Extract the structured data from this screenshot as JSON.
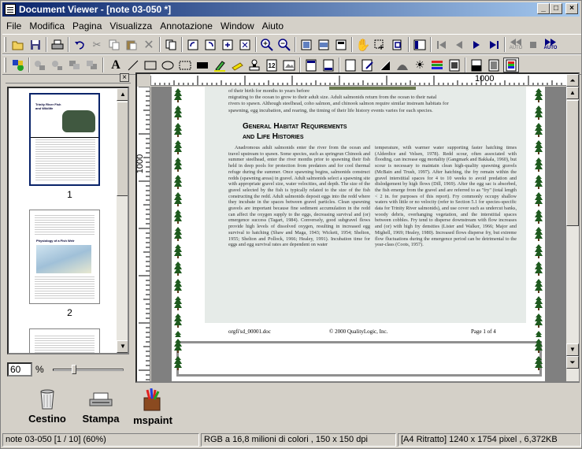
{
  "window": {
    "title": "Document Viewer - [note 03-050 *]"
  },
  "menu": [
    "File",
    "Modifica",
    "Pagina",
    "Visualizza",
    "Annotazione",
    "Window",
    "Aiuto"
  ],
  "toolbar1": {
    "auto1": "AUTO",
    "auto2": "AUTO"
  },
  "thumbs": {
    "page1": "1",
    "page2": "2",
    "t1_title": "Trinity River Fish and Wildlife",
    "t2_title": "Physiology of a Fish Weir"
  },
  "zoom": {
    "value": "60",
    "unit": "%"
  },
  "ruler": {
    "h_label": "1000",
    "v_label": "1000"
  },
  "doc": {
    "top_line1": "of their birth for months to years before",
    "top_line2": "migrating to the ocean to grow to their adult size. Adult salmonids return from the ocean to their natal",
    "top_line3": "rivers to spawn. Although steelhead, coho salmon, and chinook salmon require similar instream habitats for",
    "top_line4": "spawning, egg incubation, and rearing, the timing of their life history events varies for each species.",
    "heading1": "General Habitat Requirements",
    "heading2": "and Life Histories",
    "col1": "Anadromous adult salmonids enter the river from the ocean and travel upstream to spawn. Some species, such as springrun Chinook and summer steelhead, enter the river months prior to spawning their fish held in deep pools for protection from predators and for cool thermal refuge during the summer. Once spawning begins, salmonids construct redds (spawning areas) in gravel. Adult salmonids select a spawning site with appropriate gravel size, water velocities, and depth. The size of the gravel selected by the fish is typically related to the size of the fish constructing the redd. Adult salmonids deposit eggs into the redd where they incubate in the spaces between gravel particles. Clean spawning gravels are important because fine sediment accumulation in the redd can affect the oxygen supply to the eggs, decreasing survival and (or) emergence success (Tagart, 1984). Conversely, good subgravel flows provide high levels of dissolved oxygen, resulting in increased egg survival to hatching (Shaw and Maga, 1943; Wickett, 1954; Shelton, 1955; Shelton and Pollock, 1966; Healey, 1991). Incubation time for eggs and egg survival rates are dependent on water",
    "col2": "temperature, with warmer water supporting faster hatching times (Alderdice and Velsen, 1978). Redd scour, often associated with flooding, can increase egg mortality (Gangmark and Bakkala, 1960), but scour is necessary to maintain clean high-quality spawning gravels (McBain and Trush, 1997). After hatching, the fry remain within the gravel interstitial spaces for 4 to 10 weeks to avoid predation and dislodgement by high flows (Dill, 1969). After the egg sac is absorbed, the fish emerge from the gravel and are referred to as \"fry\" (total length < 2 in. for purposes of this report). Fry commonly occupy shallow waters with little or no velocity (refer to Section 5.1 for species-specific data for Trinity River salmonids), and use cover such as undercut banks, woody debris, overhanging vegetation, and the interstitial spaces between cobbles. Fry tend to disperse downstream with flow increases and (or) with high fry densities (Lister and Walker, 1966; Major and Mighell, 1969; Healey, 1980). Increased flows disperse fry, but extreme flow fluctuations during the emergence period can be detrimental to the year-class (Coots, 1957).",
    "footer_left": "orgfi'sd_00001.doc",
    "footer_center": "© 2000 QualityLogic, Inc.",
    "footer_right": "Page 1 of 4"
  },
  "bottom": {
    "b1": "Cestino",
    "b2": "Stampa",
    "b3": "mspaint"
  },
  "status": {
    "s1": "note 03-050 [1 / 10] (60%)",
    "s2": "RGB a 16,8 milioni di colori ,  150 x 150 dpi",
    "s3": "[A4 Ritratto]  1240 x 1754 pixel , 6,372KB"
  },
  "colors": {
    "title_start": "#0a246a",
    "title_end": "#a6caf0",
    "tree": "#1e5a1e"
  }
}
